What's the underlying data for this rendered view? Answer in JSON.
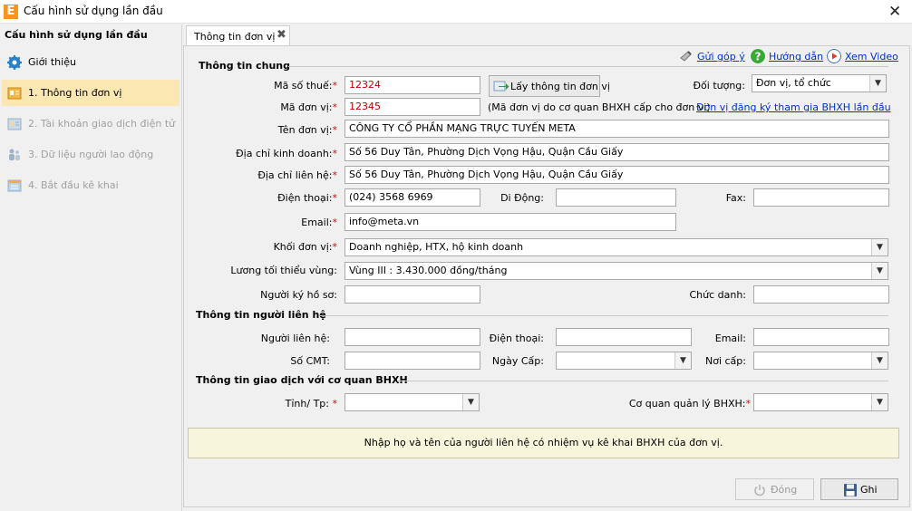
{
  "window": {
    "title": "Cấu hình sử dụng lần đầu",
    "logo": "E"
  },
  "sidebar": {
    "header": "Cấu hình sử dụng lần đầu",
    "items": [
      {
        "label": "Giới thiệu",
        "icon": "gear-icon"
      },
      {
        "label": "1. Thông tin đơn vị",
        "icon": "id-card-icon"
      },
      {
        "label": "2. Tài khoản giao dịch điện tử",
        "icon": "account-icon"
      },
      {
        "label": "3. Dữ liệu người lao động",
        "icon": "people-icon"
      },
      {
        "label": "4. Bắt đầu kê khai",
        "icon": "calendar-icon"
      }
    ]
  },
  "tab": {
    "label": "Thông tin đơn vị"
  },
  "toplinks": {
    "feedback": "Gửi góp ý",
    "guide": "Hướng dẫn",
    "video": "Xem Video"
  },
  "general": {
    "section": "Thông tin chung",
    "tax_label": "Mã số thuế:",
    "tax_value": "12324",
    "fetch_button": "Lấy thông tin đơn vị",
    "object_label": "Đối tượng:",
    "object_value": "Đơn vị, tổ chức",
    "unit_code_label": "Mã đơn vị:",
    "unit_code_value": "12345",
    "unit_code_note": "(Mã đơn vị do cơ quan BHXH cấp cho đơn vị)",
    "register_link": "Đơn vị đăng ký tham gia BHXH lần đầu",
    "unit_name_label": "Tên đơn vị:",
    "unit_name_value": "CÔNG TY CỔ PHẦN MẠNG TRỰC TUYẾN META",
    "biz_addr_label": "Địa chỉ kinh doanh:",
    "biz_addr_value": "Số 56 Duy Tân, Phường Dịch Vọng Hậu, Quận Cầu Giấy",
    "contact_addr_label": "Địa chỉ liên hệ:",
    "contact_addr_value": "Số 56 Duy Tân, Phường Dịch Vọng Hậu, Quận Cầu Giấy",
    "phone_label": "Điện thoại:",
    "phone_value": "(024) 3568 6969",
    "mobile_label": "Di Động:",
    "mobile_value": "",
    "fax_label": "Fax:",
    "fax_value": "",
    "email_label": "Email:",
    "email_value": "info@meta.vn",
    "block_label": "Khối đơn vị:",
    "block_value": "Doanh nghiệp, HTX, hộ kinh doanh",
    "wage_label": "Lương tối thiểu vùng:",
    "wage_value": "Vùng III : 3.430.000 đồng/tháng",
    "signer_label": "Người ký hồ sơ:",
    "signer_value": "",
    "title_label": "Chức danh:",
    "title_value": ""
  },
  "contact": {
    "section": "Thông tin người liên hệ",
    "person_label": "Người liên hệ:",
    "phone_label": "Điện thoại:",
    "email_label": "Email:",
    "id_label": "Số CMT:",
    "issue_date_label": "Ngày Cấp:",
    "issue_place_label": "Nơi cấp:"
  },
  "agency": {
    "section": "Thông tin giao dịch với cơ quan BHXH",
    "province_label": "Tỉnh/ Tp:",
    "agency_label": "Cơ quan quản lý BHXH:"
  },
  "hint": "Nhập họ và tên của người liên hệ có nhiệm vụ kê khai BHXH của đơn vị.",
  "buttons": {
    "close": "Đóng",
    "save": "Ghi"
  },
  "colors": {
    "active_item": "#fbe7b2",
    "required": "#ee0000",
    "link": "#0033cc",
    "hint_bg": "#f7f6dc"
  }
}
